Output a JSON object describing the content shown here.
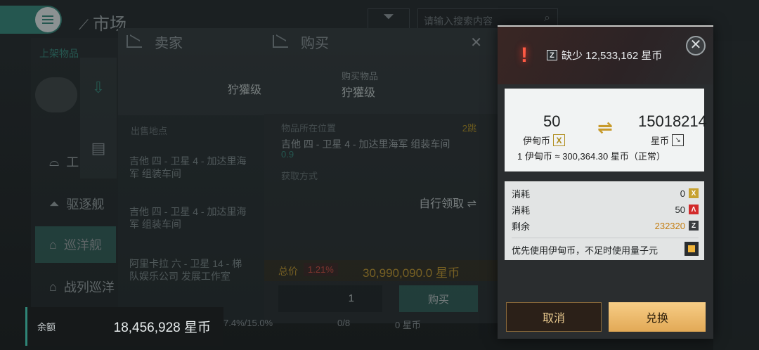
{
  "market": {
    "title": "市场",
    "search_placeholder": "请输入搜索内容",
    "listed_items_label": "上架物品",
    "categories": [
      {
        "label": "工"
      },
      {
        "label": "驱逐舰"
      },
      {
        "label": "巡洋舰"
      },
      {
        "label": "战列巡洋"
      }
    ]
  },
  "seller_panel": {
    "tab_label": "卖家",
    "ship_class": "狞獾级",
    "location_header": "出售地点",
    "locations": [
      {
        "text": "吉他 四 - 卫星 4 - 加达里海军 组装车间"
      },
      {
        "text": "吉他 四 - 卫星 4 - 加达里海军 组装车间"
      },
      {
        "text": "阿里卡拉 六 - 卫星 14 - 梯队娱乐公司 发展工作室"
      }
    ]
  },
  "buy_panel": {
    "tab_label": "购买",
    "item_label": "购买物品",
    "ship_class": "狞獾级",
    "item_location_label": "物品所在位置",
    "jumps": "2跳",
    "location": "吉他 四 - 卫星 4 - 加达里海军 组装车间",
    "security": "0.9",
    "acquire_label": "获取方式",
    "acquire_value": "自行领取",
    "total_label": "总价",
    "tax": "1.21%",
    "total_value": "30,990,090.0 星币",
    "quantity": "1",
    "buy_button": "购买"
  },
  "footer": {
    "balance_label": "余额",
    "balance_value": "18,456,928 星币",
    "stat_percent": "7.4%/15.0%",
    "stat_count": "0/8",
    "stat_coins": "0 星币"
  },
  "exchange_modal": {
    "shortage_text": "缺少 12,533,162 星币",
    "from_amount": "50",
    "from_currency": "伊甸币",
    "to_amount": "15018214",
    "to_currency": "星币",
    "rate_text": "1 伊甸币 ≈ 300,364.30 星币（正常）",
    "cost_rows": [
      {
        "label": "消耗",
        "value": "0",
        "icon": "isk-coin-icon"
      },
      {
        "label": "消耗",
        "value": "50",
        "icon": "red-currency-icon"
      }
    ],
    "remaining_label": "剩余",
    "remaining_value": "232320",
    "preference_text": "优先使用伊甸币，不足时使用量子元",
    "cancel_label": "取消",
    "confirm_label": "兑换",
    "colors": {
      "accent_gold": "#e2a956",
      "warning_red": "#ff5a44",
      "remaining_orange": "#c47e12"
    }
  }
}
